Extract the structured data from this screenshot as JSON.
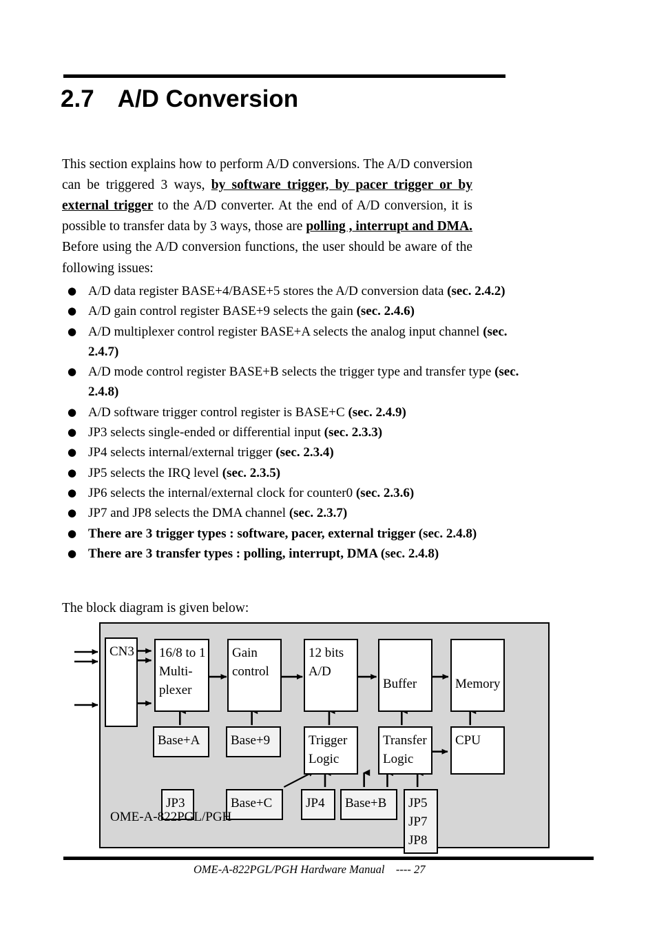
{
  "section": {
    "number": "2.7",
    "title": "A/D Conversion"
  },
  "intro": {
    "p1": "This section explains how to perform A/D conversions. The A/D conversion can be triggered 3 ways, ",
    "b1": "by software trigger, by pacer trigger or by external trigger",
    "p2": " to the A/D converter. At the end of A/D conversion, it is possible to transfer data by 3 ways, those are ",
    "b2": "polling , interrupt and DMA.",
    "p3": " Before using the A/D conversion functions, the user should be aware of the following issues:"
  },
  "bullets": [
    {
      "bullet": "●",
      "text": "A/D data register BASE+4/BASE+5 stores the A/D conversion data ",
      "ref": "(sec. 2.4.2)",
      "bold": false
    },
    {
      "bullet": "●",
      "text": "A/D gain control register BASE+9 selects the gain ",
      "ref": "(sec. 2.4.6)",
      "bold": false
    },
    {
      "bullet": "●",
      "text": "A/D multiplexer control register BASE+A selects the analog input channel ",
      "ref": "(sec. 2.4.7)",
      "bold": false
    },
    {
      "bullet": "●",
      "text": "A/D mode control register BASE+B selects the trigger type and transfer type ",
      "ref": "(sec. 2.4.8)",
      "bold": false
    },
    {
      "bullet": "●",
      "text": "A/D software trigger control register is BASE+C ",
      "ref": "(sec. 2.4.9)",
      "bold": false
    },
    {
      "bullet": "●",
      "text": "JP3 selects single-ended or differential input ",
      "ref": "(sec. 2.3.3)",
      "bold": false
    },
    {
      "bullet": "●",
      "text": "JP4 selects internal/external trigger ",
      "ref": "(sec. 2.3.4)",
      "bold": false
    },
    {
      "bullet": "●",
      "text": "JP5 selects the IRQ level ",
      "ref": "(sec. 2.3.5)",
      "bold": false
    },
    {
      "bullet": "●",
      "text": "JP6 selects the internal/external clock for counter0 ",
      "ref": "(sec. 2.3.6)",
      "bold": false
    },
    {
      "bullet": "●",
      "text": "JP7 and JP8 selects the DMA channel ",
      "ref": "(sec. 2.3.7)",
      "bold": false
    },
    {
      "bullet": "●",
      "text": "There are 3 trigger types : software, pacer, external trigger (sec. 2.4.8)",
      "ref": "",
      "bold": true
    },
    {
      "bullet": "●",
      "text": "There are 3 transfer types : polling, interrupt, DMA (sec. 2.4.8)",
      "ref": "",
      "bold": true
    }
  ],
  "lead_in": "The block diagram is given below:",
  "diagram": {
    "caption": "OME-A-822PGL/PGH",
    "background_color": "#d6d6d6",
    "boxes": {
      "cn3": "CN3",
      "mux_l1": "16/8 to 1",
      "mux_l2": "Multi-",
      "mux_l3": "plexer",
      "gain_l1": "Gain",
      "gain_l2": "control",
      "adc_l1": "12 bits",
      "adc_l2": "A/D",
      "buffer": "Buffer",
      "memory": "Memory",
      "base_a": "Base+A",
      "base_9": "Base+9",
      "trigger_l1": "Trigger",
      "trigger_l2": "Logic",
      "transfer_l1": "Transfer",
      "transfer_l2": "Logic",
      "cpu": "CPU",
      "jp3": "JP3",
      "base_c": "Base+C",
      "jp4": "JP4",
      "base_b": "Base+B",
      "jp5": "JP5",
      "jp7": "JP7",
      "jp8": "JP8"
    }
  },
  "footer": {
    "text": "OME-A-822PGL/PGH Hardware Manual    ---- 27"
  }
}
